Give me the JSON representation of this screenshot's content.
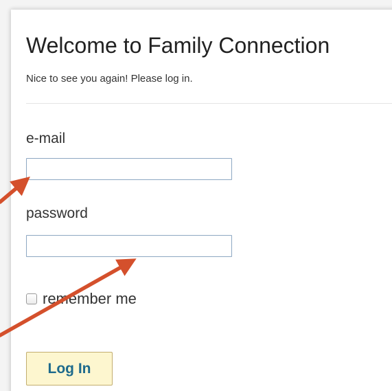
{
  "form": {
    "title": "Welcome to Family Connection",
    "subtitle": "Nice to see you again! Please log in.",
    "email_label": "e-mail",
    "email_value": "",
    "password_label": "password",
    "password_value": "",
    "remember_label": "remember me",
    "remember_checked": false,
    "login_label": "Log In"
  },
  "annotations": {
    "arrow_color": "#d4502c"
  },
  "colors": {
    "button_background": "#fdf6cf",
    "button_text": "#1e6a8c",
    "field_border": "#8da7c2"
  }
}
